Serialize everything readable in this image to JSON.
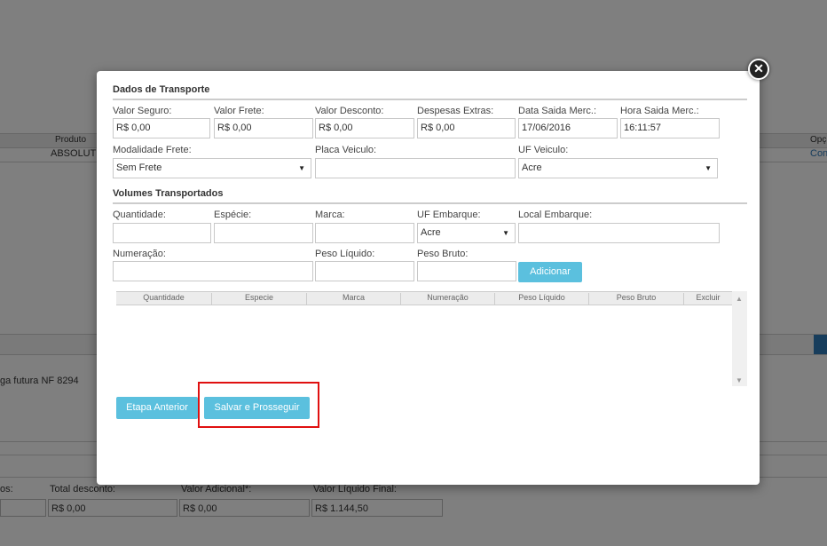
{
  "background": {
    "grid_headers": {
      "produto": "Produto",
      "opcoes": "Opç"
    },
    "grid_row": {
      "produto": "ABSOLUT",
      "opcoes": "Con"
    },
    "note": "ga futura NF 8294",
    "totals": [
      {
        "label": "os:",
        "value": ""
      },
      {
        "label": "Total desconto:",
        "value": "R$ 0,00"
      },
      {
        "label": "Valor Adicional*:",
        "value": "R$ 0,00"
      },
      {
        "label": "Valor Líquido Final:",
        "value": "R$ 1.144,50"
      }
    ]
  },
  "modal": {
    "close_icon": "✕",
    "transport": {
      "title": "Dados de Transporte",
      "valor_seguro": {
        "label": "Valor Seguro:",
        "value": "R$ 0,00"
      },
      "valor_frete": {
        "label": "Valor Frete:",
        "value": "R$ 0,00"
      },
      "valor_desconto": {
        "label": "Valor Desconto:",
        "value": "R$ 0,00"
      },
      "despesas_extras": {
        "label": "Despesas Extras:",
        "value": "R$ 0,00"
      },
      "data_saida": {
        "label": "Data Saida Merc.:",
        "value": "17/06/2016"
      },
      "hora_saida": {
        "label": "Hora Saida Merc.:",
        "value": "16:11:57"
      },
      "modalidade_frete": {
        "label": "Modalidade Frete:",
        "value": "Sem Frete"
      },
      "placa_veiculo": {
        "label": "Placa Veiculo:",
        "value": ""
      },
      "uf_veiculo": {
        "label": "UF Veiculo:",
        "value": "Acre"
      }
    },
    "volumes": {
      "title": "Volumes Transportados",
      "quantidade": {
        "label": "Quantidade:",
        "value": ""
      },
      "especie": {
        "label": "Espécie:",
        "value": ""
      },
      "marca": {
        "label": "Marca:",
        "value": ""
      },
      "uf_embarque": {
        "label": "UF Embarque:",
        "value": "Acre"
      },
      "local_embarque": {
        "label": "Local Embarque:",
        "value": ""
      },
      "numeracao": {
        "label": "Numeração:",
        "value": ""
      },
      "peso_liquido": {
        "label": "Peso Líquido:",
        "value": ""
      },
      "peso_bruto": {
        "label": "Peso Bruto:",
        "value": ""
      },
      "add_button": "Adicionar",
      "table_headers": [
        "Quantidade",
        "Especie",
        "Marca",
        "Numeração",
        "Peso Líquido",
        "Peso Bruto",
        "Excluir"
      ]
    },
    "buttons": {
      "previous": "Etapa Anterior",
      "save": "Salvar e Prosseguir"
    }
  },
  "colors": {
    "button": "#5bc0de",
    "highlight": "#e01010",
    "overlay": "rgba(0,0,0,0.5)"
  }
}
